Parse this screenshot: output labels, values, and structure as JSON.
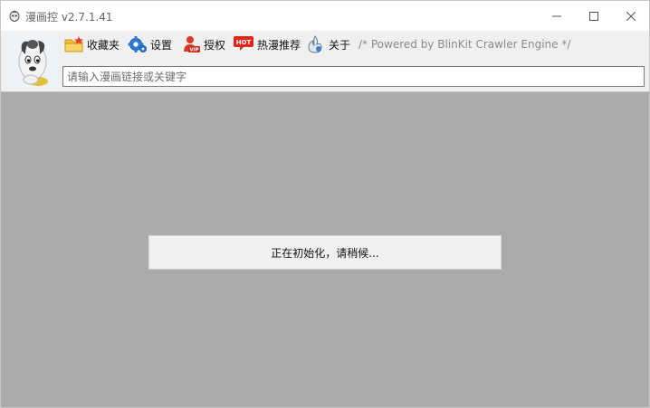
{
  "window": {
    "title": "漫画控 v2.7.1.41",
    "icon": "mascot-icon",
    "controls": {
      "minimize": "minimize-icon",
      "maximize": "maximize-icon",
      "close": "close-icon"
    }
  },
  "toolbar": {
    "items": [
      {
        "label": "收藏夹",
        "icon": "folder-star-icon"
      },
      {
        "label": "设置",
        "icon": "gear-icon"
      },
      {
        "label": "授权",
        "icon": "vip-user-icon"
      },
      {
        "label": "热漫推荐",
        "icon": "hot-badge-icon",
        "badge": "HOT"
      },
      {
        "label": "关于",
        "icon": "info-icon"
      }
    ],
    "powered": "/* Powered by BlinKit Crawler Engine */"
  },
  "search": {
    "placeholder": "请输入漫画链接或关键字",
    "value": ""
  },
  "status": {
    "message": "正在初始化，请稍候..."
  },
  "colors": {
    "body_background": "#ababab",
    "toolbar_background": "#f0f0f0",
    "dialog_background": "#f0f0f0"
  }
}
